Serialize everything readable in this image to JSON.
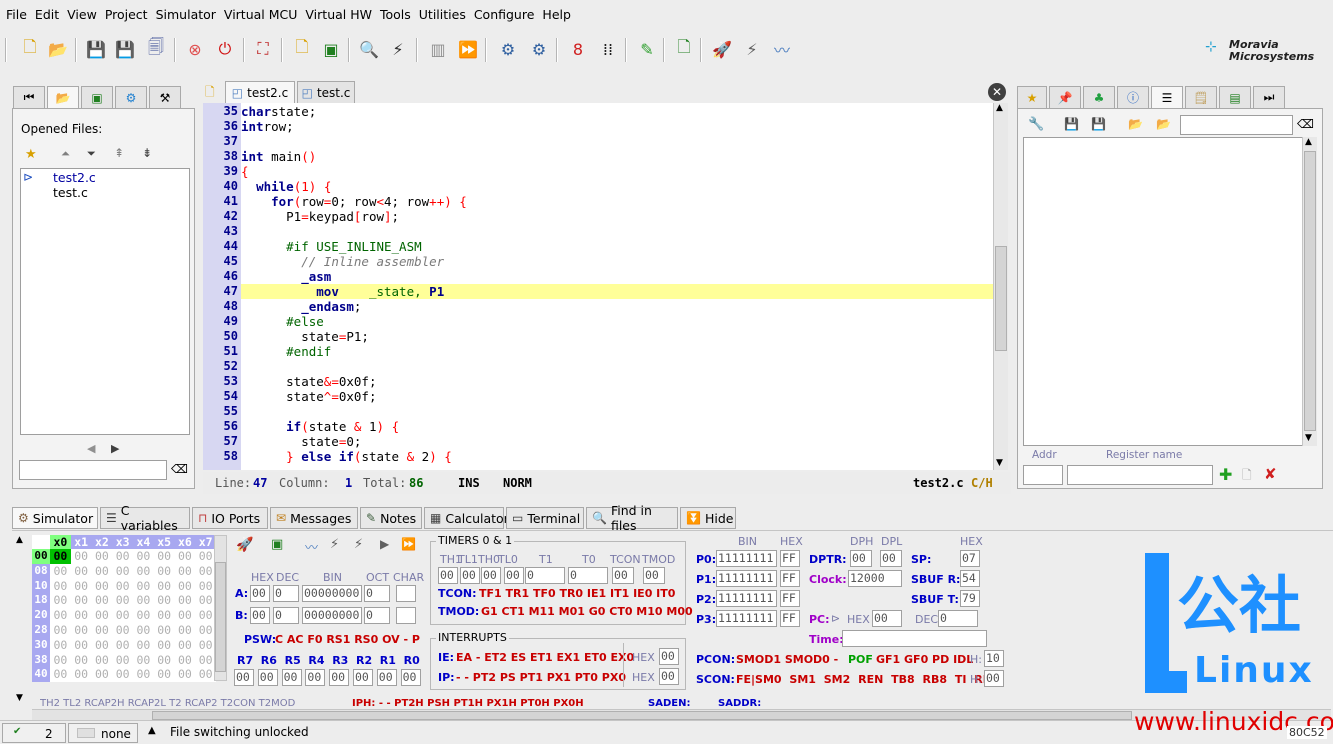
{
  "menu": [
    "File",
    "Edit",
    "View",
    "Project",
    "Simulator",
    "Virtual MCU",
    "Virtual HW",
    "Tools",
    "Utilities",
    "Configure",
    "Help"
  ],
  "logo": {
    "line1": "Moravia",
    "line2": "Microsystems"
  },
  "left_panel": {
    "title": "Opened Files:",
    "files": [
      "test2.c",
      "test.c"
    ],
    "search_value": ""
  },
  "editor": {
    "tabs": [
      {
        "label": "test2.c",
        "active": true
      },
      {
        "label": "test.c",
        "active": false
      }
    ],
    "highlight_line": 47,
    "status": {
      "line_label": "Line:",
      "line": "47",
      "col_label": "Column:",
      "col": "1",
      "total_label": "Total:",
      "total": "86",
      "mode1": "INS",
      "mode2": "NORM",
      "file": "test2.c",
      "type": "C/H"
    },
    "lines": [
      {
        "n": "35",
        "code": [
          [
            "kw",
            "char"
          ],
          [
            "",
            "state;"
          ]
        ]
      },
      {
        "n": "36",
        "code": [
          [
            "kw",
            "int"
          ],
          [
            "",
            "row;"
          ]
        ]
      },
      {
        "n": "37",
        "code": []
      },
      {
        "n": "38",
        "code": [
          [
            "kw",
            "int"
          ],
          [
            "",
            " main"
          ],
          [
            "sym",
            "()"
          ]
        ]
      },
      {
        "n": "39",
        "code": [
          [
            "sym",
            "{"
          ]
        ]
      },
      {
        "n": "40",
        "code": [
          [
            "",
            "  "
          ],
          [
            "kw",
            "while"
          ],
          [
            "sym",
            "(1)"
          ],
          [
            "",
            " "
          ],
          [
            "sym",
            "{"
          ]
        ]
      },
      {
        "n": "41",
        "code": [
          [
            "",
            "    "
          ],
          [
            "kw",
            "for"
          ],
          [
            "sym",
            "("
          ],
          [
            "",
            "row"
          ],
          [
            "sym",
            "="
          ],
          [
            "",
            "0; row"
          ],
          [
            "sym",
            "<"
          ],
          [
            "",
            "4; row"
          ],
          [
            "sym",
            "++)"
          ],
          [
            "",
            " "
          ],
          [
            "sym",
            "{"
          ]
        ]
      },
      {
        "n": "42",
        "code": [
          [
            "",
            "      P1"
          ],
          [
            "sym",
            "="
          ],
          [
            "",
            "keypad"
          ],
          [
            "sym",
            "["
          ],
          [
            "",
            "row"
          ],
          [
            "sym",
            "]"
          ],
          [
            "",
            ";"
          ]
        ]
      },
      {
        "n": "43",
        "code": []
      },
      {
        "n": "44",
        "code": [
          [
            "",
            "      "
          ],
          [
            "pp",
            "#if USE_INLINE_ASM"
          ]
        ]
      },
      {
        "n": "45",
        "code": [
          [
            "",
            "        "
          ],
          [
            "cm",
            "// Inline assembler"
          ]
        ]
      },
      {
        "n": "46",
        "code": [
          [
            "",
            "        "
          ],
          [
            "kw",
            "_asm"
          ]
        ]
      },
      {
        "n": "47",
        "code": [
          [
            "",
            "          "
          ],
          [
            "kw",
            "mov"
          ],
          [
            "",
            "    "
          ],
          [
            "pp",
            "_state,"
          ],
          [
            "kw",
            " P1"
          ]
        ]
      },
      {
        "n": "48",
        "code": [
          [
            "",
            "        "
          ],
          [
            "kw",
            "_endasm"
          ],
          [
            "",
            ";"
          ]
        ]
      },
      {
        "n": "49",
        "code": [
          [
            "",
            "      "
          ],
          [
            "pp",
            "#else"
          ]
        ]
      },
      {
        "n": "50",
        "code": [
          [
            "",
            "        state"
          ],
          [
            "sym",
            "="
          ],
          [
            "",
            "P1;"
          ]
        ]
      },
      {
        "n": "51",
        "code": [
          [
            "",
            "      "
          ],
          [
            "pp",
            "#endif"
          ]
        ]
      },
      {
        "n": "52",
        "code": []
      },
      {
        "n": "53",
        "code": [
          [
            "",
            "      state"
          ],
          [
            "sym",
            "&="
          ],
          [
            "",
            "0x0f;"
          ]
        ]
      },
      {
        "n": "54",
        "code": [
          [
            "",
            "      state"
          ],
          [
            "sym",
            "^="
          ],
          [
            "",
            "0x0f;"
          ]
        ]
      },
      {
        "n": "55",
        "code": []
      },
      {
        "n": "56",
        "code": [
          [
            "",
            "      "
          ],
          [
            "kw",
            "if"
          ],
          [
            "sym",
            "("
          ],
          [
            "",
            "state "
          ],
          [
            "sym",
            "&"
          ],
          [
            "",
            " 1"
          ],
          [
            "sym",
            ")"
          ],
          [
            "",
            " "
          ],
          [
            "sym",
            "{"
          ]
        ]
      },
      {
        "n": "57",
        "code": [
          [
            "",
            "        state"
          ],
          [
            "sym",
            "="
          ],
          [
            "",
            "0;"
          ]
        ]
      },
      {
        "n": "58",
        "code": [
          [
            "",
            "      "
          ],
          [
            "sym",
            "}"
          ],
          [
            "",
            " "
          ],
          [
            "kw",
            "else if"
          ],
          [
            "sym",
            "("
          ],
          [
            "",
            "state "
          ],
          [
            "sym",
            "&"
          ],
          [
            "",
            " 2"
          ],
          [
            "sym",
            ")"
          ],
          [
            "",
            " "
          ],
          [
            "sym",
            "{"
          ]
        ]
      }
    ]
  },
  "right_panel": {
    "addr_label": "Addr",
    "reg_label": "Register name",
    "search_value": ""
  },
  "bottom_tabs": [
    "Simulator",
    "C variables",
    "IO Ports",
    "Messages",
    "Notes",
    "Calculator",
    "Terminal",
    "Find in files",
    "Hide"
  ],
  "memory": {
    "cols": [
      "x0",
      "x1",
      "x2",
      "x3",
      "x4",
      "x5",
      "x6",
      "x7"
    ],
    "rows": [
      "00",
      "08",
      "10",
      "18",
      "20",
      "28",
      "30",
      "38",
      "40"
    ],
    "value": "00"
  },
  "regs": {
    "hdr": [
      "HEX",
      "DEC",
      "BIN",
      "OCT",
      "CHAR"
    ],
    "a": {
      "label": "A:",
      "hex": "00",
      "dec": "0",
      "bin": "00000000",
      "oct": "0"
    },
    "b": {
      "label": "B:",
      "hex": "00",
      "dec": "0",
      "bin": "00000000",
      "oct": "0"
    },
    "psw_label": "PSW:",
    "psw_flags": "C AC F0 RS1 RS0 OV - P",
    "r_names": [
      "R7",
      "R6",
      "R5",
      "R4",
      "R3",
      "R2",
      "R1",
      "R0"
    ],
    "r_values": [
      "00",
      "00",
      "00",
      "00",
      "00",
      "00",
      "00",
      "00"
    ]
  },
  "timers": {
    "title": "TIMERS 0 & 1",
    "hdr": [
      "TH1",
      "TL1",
      "TH0",
      "TL0",
      "T1",
      "T0",
      "TCON",
      "TMOD"
    ],
    "values": [
      "00",
      "00",
      "00",
      "00",
      "0",
      "0",
      "00",
      "00"
    ],
    "tcon_label": "TCON:",
    "tcon": "TF1 TR1 TF0 TR0 IE1 IT1 IE0 IT0",
    "tmod_label": "TMOD:",
    "tmod": "G1 CT1 M11 M01 G0 CT0 M10 M00"
  },
  "interrupts": {
    "title": "INTERRUPTS",
    "ie_label": "IE:",
    "ie": "EA - ET2 ES ET1 EX1 ET0 EX0",
    "ip_label": "IP:",
    "ip": "- - PT2 PS PT1 PX1 PT0 PX0",
    "hex": "HEX",
    "ie_val": "00",
    "ip_val": "00"
  },
  "ports": {
    "bin": "BIN",
    "hex": "HEX",
    "items": [
      {
        "label": "P0:",
        "bin": "11111111",
        "hex": "FF"
      },
      {
        "label": "P1:",
        "bin": "11111111",
        "hex": "FF"
      },
      {
        "label": "P2:",
        "bin": "11111111",
        "hex": "FF"
      },
      {
        "label": "P3:",
        "bin": "11111111",
        "hex": "FF"
      }
    ]
  },
  "misc": {
    "dph": "DPH",
    "dpl": "DPL",
    "dptr_label": "DPTR:",
    "dph_val": "00",
    "dpl_val": "00",
    "clock_label": "Clock:",
    "clock": "12000",
    "sp_label": "SP:",
    "sp": "07",
    "hex": "HEX",
    "sbufr_label": "SBUF R:",
    "sbufr": "54",
    "sbuft_label": "SBUF T:",
    "sbuft": "79",
    "pc_label": "PC:",
    "pc_hex_label": "HEX",
    "pc_hex": "00",
    "pc_dec_label": "DEC",
    "pc_dec": "0",
    "time_label": "Time:",
    "time": "",
    "pcon_label": "PCON:",
    "pcon": "SMOD1 SMOD0 - ",
    "pcon2": "POF",
    "pcon3": "GF1 GF0 PD IDL",
    "pcon_h": "H:",
    "pcon_val": "10",
    "scon_label": "SCON:",
    "scon": "FE|SM0 SM1 SM2 REN TB8 RB8 TI RI",
    "scon_h": "H:",
    "scon_val": "00"
  },
  "cut_row": "TH2 TL2 RCAP2H RCAP2L    T2      RCAP2  T2CON T2MOD",
  "cut_row2": "IPH: - - PT2H PSH PT1H PX1H PT0H PX0H",
  "cut_row3": "SADEN:",
  "cut_row4": "SADDR:",
  "bottom_status": {
    "count": "2",
    "mode": "none",
    "message": "File switching unlocked",
    "cpu": "80C52"
  },
  "watermark": {
    "site": "www.linuxidc.com",
    "brand": "Linux",
    "cn": "公社"
  }
}
